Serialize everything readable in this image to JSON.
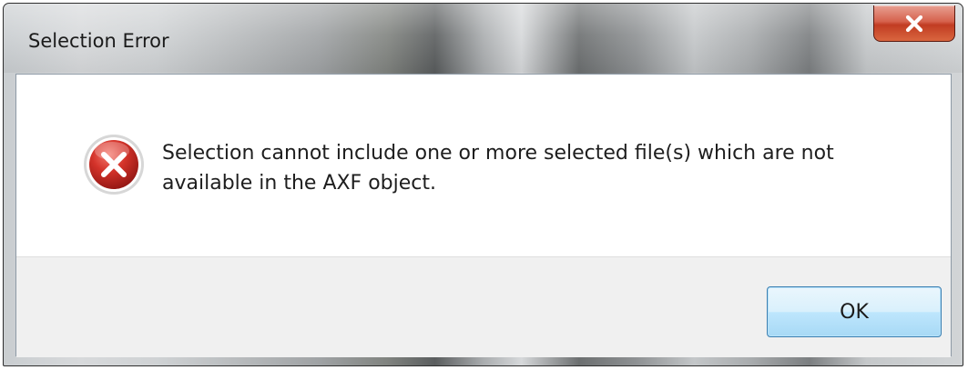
{
  "window": {
    "title": "Selection Error"
  },
  "titlebar": {
    "close_icon": "close-icon"
  },
  "message": {
    "icon": "error-icon",
    "text": "Selection cannot include one or more selected file(s) which are not available in the AXF object."
  },
  "buttons": {
    "ok_label": "OK"
  },
  "colors": {
    "close_button": "#c8452b",
    "error_icon": "#c2281f",
    "ok_button_border": "#3c7fb1",
    "button_area_bg": "#f0f0f0"
  }
}
